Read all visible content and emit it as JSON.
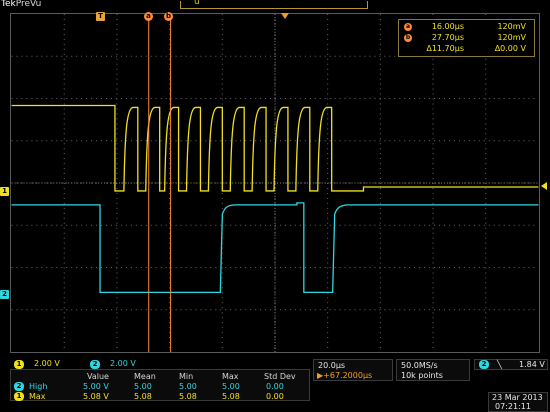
{
  "header": {
    "brand_tek": "Tek",
    "brand_mode": "PreVu",
    "record_marker": "u"
  },
  "markers": {
    "trigger": "T",
    "cursor_a": "a",
    "cursor_b": "b",
    "ch1": "1",
    "ch2": "2"
  },
  "cursor_readout": {
    "a_time": "16.00µs",
    "a_volt": "120mV",
    "b_time": "27.70µs",
    "b_volt": "120mV",
    "delta_time": "Δ11.70µs",
    "delta_volt": "Δ0.00 V"
  },
  "channels": {
    "ch1_badge": "1",
    "ch1_scale": "2.00 V",
    "ch2_badge": "2",
    "ch2_scale": "2.00 V"
  },
  "measurements": {
    "headers": [
      "Value",
      "Mean",
      "Min",
      "Max",
      "Std Dev"
    ],
    "rows": [
      {
        "badge": "2",
        "label": "High",
        "values": [
          "5.00 V",
          "5.00",
          "5.00",
          "5.00",
          "0.00"
        ]
      },
      {
        "badge": "1",
        "label": "Max",
        "values": [
          "5.08 V",
          "5.08",
          "5.08",
          "5.08",
          "0.00"
        ]
      }
    ]
  },
  "timebase": {
    "scale": "20.0µs",
    "position": "▶+67.2000µs"
  },
  "acquisition": {
    "sample_rate": "50.0MS/s",
    "record_length": "10k points"
  },
  "trigger": {
    "source_badge": "2",
    "slope": "╲",
    "level": "1.84 V"
  },
  "datetime": {
    "date": "23 Mar 2013",
    "time": "07:21:11"
  },
  "colors": {
    "ch1": "#f0e020",
    "ch2": "#2fd8e0",
    "cursor": "#ff8a3a",
    "grid": "#6a6a6a"
  }
}
